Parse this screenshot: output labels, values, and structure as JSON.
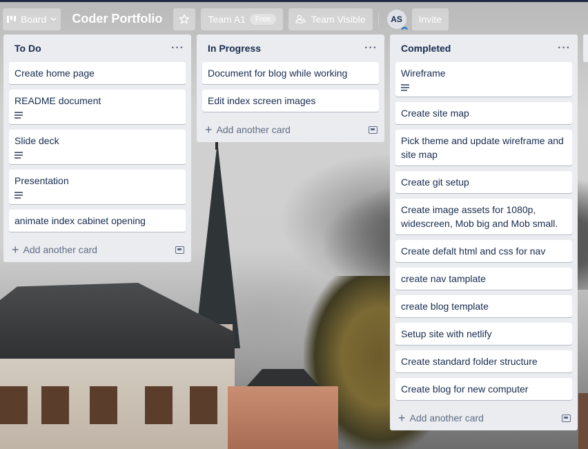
{
  "header": {
    "board_switcher_label": "Board",
    "board_title": "Coder Portfolio",
    "team_label": "Team A1",
    "team_badge": "Free",
    "visibility_label": "Team Visible",
    "avatar_initials": "AS",
    "invite_label": "Invite"
  },
  "lists": [
    {
      "title": "To Do",
      "cards": [
        {
          "title": "Create home page",
          "has_description": false
        },
        {
          "title": "README document",
          "has_description": true
        },
        {
          "title": "Slide deck",
          "has_description": true
        },
        {
          "title": "Presentation",
          "has_description": true
        },
        {
          "title": "animate index cabinet opening",
          "has_description": false
        }
      ],
      "add_card_label": "Add another card"
    },
    {
      "title": "In Progress",
      "cards": [
        {
          "title": "Document for blog while working",
          "has_description": false
        },
        {
          "title": "Edit index screen images",
          "has_description": false
        }
      ],
      "add_card_label": "Add another card"
    },
    {
      "title": "Completed",
      "cards": [
        {
          "title": "Wireframe",
          "has_description": true
        },
        {
          "title": "Create site map",
          "has_description": false
        },
        {
          "title": "Pick theme and update wireframe and site map",
          "has_description": false
        },
        {
          "title": "Create git setup",
          "has_description": false
        },
        {
          "title": "Create image assets for 1080p, widescreen, Mob big and Mob small.",
          "has_description": false
        },
        {
          "title": "Create defalt html and css for nav",
          "has_description": false
        },
        {
          "title": "create nav tamplate",
          "has_description": false
        },
        {
          "title": "create blog template",
          "has_description": false
        },
        {
          "title": "Setup site with netlify",
          "has_description": false
        },
        {
          "title": "Create standard folder structure",
          "has_description": false
        },
        {
          "title": "Create blog for new computer",
          "has_description": false
        }
      ],
      "add_card_label": "Add another card"
    }
  ],
  "icons": {
    "board": "board-icon",
    "chevron": "chevron-down-icon",
    "star": "star-icon",
    "visibility": "team-visible-icon",
    "list_menu": "more-horizontal-icon",
    "description": "description-icon",
    "add": "plus-icon",
    "template": "card-template-icon"
  },
  "colors": {
    "topbar_button_bg": "rgba(255,255,255,0.35)",
    "list_bg": "#ebecf0",
    "card_bg": "#ffffff",
    "text_primary": "#172b4d",
    "text_secondary": "#5e6c84"
  }
}
